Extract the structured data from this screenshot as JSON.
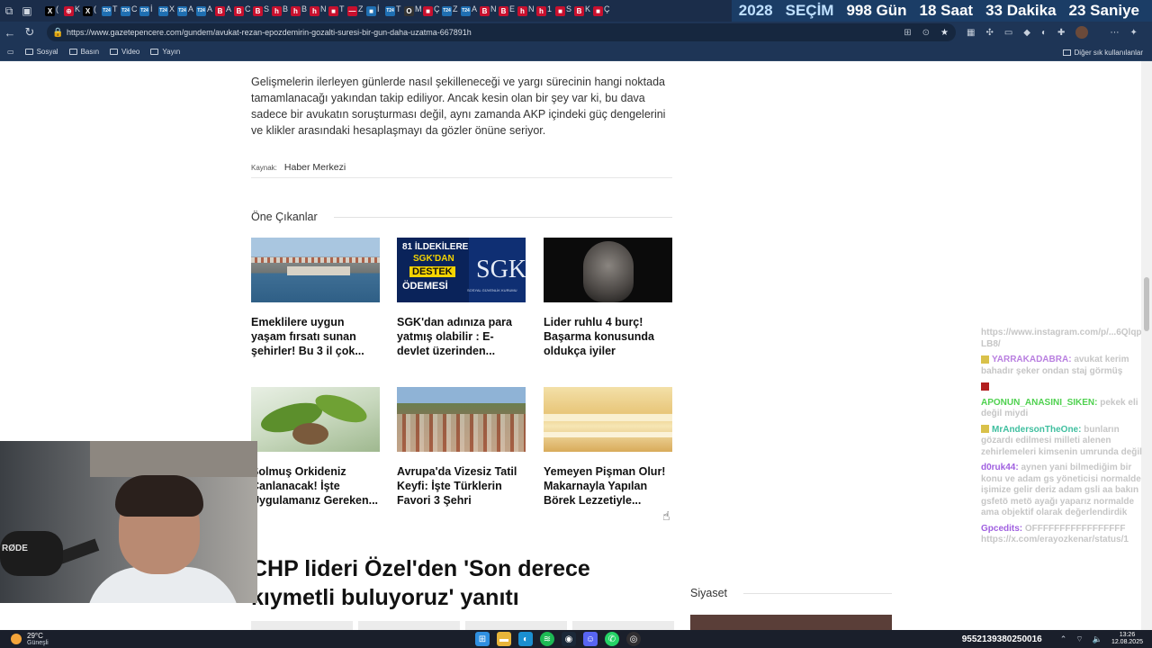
{
  "browser": {
    "tabs": [
      {
        "fav": "X",
        "color": "#000000",
        "t": "("
      },
      {
        "fav": "⊕",
        "color": "#c8102e",
        "t": "K"
      },
      {
        "fav": "X",
        "color": "#000000",
        "t": "("
      },
      {
        "fav": "T24",
        "color": "#1f6fb2",
        "t": "T"
      },
      {
        "fav": "T24",
        "color": "#1f6fb2",
        "t": "C"
      },
      {
        "fav": "T24",
        "color": "#1f6fb2",
        "t": "İ"
      },
      {
        "fav": "T24",
        "color": "#1f6fb2",
        "t": "X"
      },
      {
        "fav": "T24",
        "color": "#1f6fb2",
        "t": "A"
      },
      {
        "fav": "T24",
        "color": "#1f6fb2",
        "t": "A"
      },
      {
        "fav": "B",
        "color": "#c8102e",
        "t": "A"
      },
      {
        "fav": "B",
        "color": "#c8102e",
        "t": "C"
      },
      {
        "fav": "B",
        "color": "#c8102e",
        "t": "S"
      },
      {
        "fav": "h",
        "color": "#c8102e",
        "t": "B"
      },
      {
        "fav": "h",
        "color": "#c8102e",
        "t": "B"
      },
      {
        "fav": "h",
        "color": "#c8102e",
        "t": "N"
      },
      {
        "fav": "■",
        "color": "#c8102e",
        "t": "T"
      },
      {
        "fav": "—",
        "color": "#c8102e",
        "t": "Z"
      },
      {
        "fav": "■",
        "color": "#1f6fb2",
        "t": "İ"
      },
      {
        "fav": "T24",
        "color": "#1f6fb2",
        "t": "T"
      },
      {
        "fav": "O",
        "color": "#333333",
        "t": "M"
      },
      {
        "fav": "■",
        "color": "#c8102e",
        "t": "Ç"
      },
      {
        "fav": "T24",
        "color": "#1f6fb2",
        "t": "Z"
      },
      {
        "fav": "T24",
        "color": "#1f6fb2",
        "t": "A"
      },
      {
        "fav": "B",
        "color": "#c8102e",
        "t": "N"
      },
      {
        "fav": "B",
        "color": "#c8102e",
        "t": "E"
      },
      {
        "fav": "h",
        "color": "#c8102e",
        "t": "N"
      },
      {
        "fav": "h",
        "color": "#c8102e",
        "t": "1"
      },
      {
        "fav": "■",
        "color": "#c8102e",
        "t": "S"
      },
      {
        "fav": "B",
        "color": "#c8102e",
        "t": "K"
      },
      {
        "fav": "■",
        "color": "#c8102e",
        "t": "Ç"
      }
    ],
    "countdown": [
      "2028",
      "SEÇİM",
      "998 Gün",
      "18 Saat",
      "33 Dakika",
      "23 Saniye"
    ],
    "url": "https://www.gazetepencere.com/gundem/avukat-rezan-epozdemirin-gozalti-suresi-bir-gun-daha-uzatma-667891h",
    "bookmarks": [
      "Sosyal",
      "Basın",
      "Video",
      "Yayın"
    ],
    "bookmarks_other": "Diğer sık kullanılanlar"
  },
  "article": {
    "paragraph": "Gelişmelerin ilerleyen günlerde nasıl şekilleneceği ve yargı sürecinin hangi noktada tamamlanacağı yakından takip ediliyor. Ancak kesin olan bir şey var ki, bu dava sadece bir avukatın soruşturması değil, aynı zamanda AKP içindeki güç dengelerini ve klikler arasındaki hesaplaşmayı da gözler önüne seriyor.",
    "source_label": "Kaynak:",
    "source_value": "Haber Merkezi"
  },
  "featured": {
    "title": "Öne Çıkanlar",
    "cards": [
      {
        "title": "Emeklilere uygun yaşam fırsatı sunan şehirler! Bu 3 il çok..."
      },
      {
        "title": "SGK'dan adınıza para yatmış olabilir : E-devlet üzerinden..."
      },
      {
        "title": "Lider ruhlu 4 burç! Başarma konusunda oldukça iyiler"
      },
      {
        "title": "Solmuş Orkideniz Canlanacak! İşte Uygulamanız Gereken..."
      },
      {
        "title": "Avrupa'da Vizesiz Tatil Keyfi: İşte Türklerin Favori 3 Şehri"
      },
      {
        "title": "Yemeyen Pişman Olur! Makarnayla Yapılan Börek Lezzetiyle..."
      }
    ],
    "sgk_overlay": {
      "line1": "81 İLDEKİLERE",
      "line2": "SGK'DAN",
      "line3": "DESTEK",
      "line4": "ÖDEMESİ",
      "logo": "SGK",
      "sub": "SOSYAL GÜVENLİK KURUMU"
    }
  },
  "hero_title": "CHP lideri Özel'den 'Son derece kıymetli buluyoruz' yanıtı",
  "sidebar": {
    "title": "Siyaset"
  },
  "webcam": {
    "mic_brand": "RØDE"
  },
  "chat": [
    {
      "user": "",
      "text": "https://www.instagram.com/p/...6QlqpLB8/",
      "color": "#c6c6c6",
      "badge": ""
    },
    {
      "user": "YARRAKADABRA:",
      "text": "avukat kerim bahadır şeker ondan staj görmüş",
      "color": "#b97fe0",
      "badge": "gold"
    },
    {
      "user": "",
      "text": "",
      "color": "#c6c6c6",
      "badge": "red"
    },
    {
      "user": "APONUN_ANASINI_SIKEN:",
      "text": "pekek eli değil miydi",
      "color": "#4fd14f",
      "badge": ""
    },
    {
      "user": "MrAndersonTheOne:",
      "text": "bunların gözardı edilmesi milleti alenen zehirlemeleri kimsenin umrunda değil",
      "color": "#3fbf9f",
      "badge": "gold"
    },
    {
      "user": "d0ruk44:",
      "text": "aynen yani bilmediğim bir konu ve adam gs yöneticisi normalde işimize gelir deriz adam gsli aa bakın gsfetö metö ayağı yaparız normalde ama objektif olarak değerlendirdik",
      "color": "#a060e0",
      "badge": ""
    },
    {
      "user": "Gpcedits:",
      "text": "OFFFFFFFFFFFFFFFFF https://x.com/erayozkenar/status/1",
      "color": "#a060e0",
      "badge": ""
    }
  ],
  "taskbar": {
    "temp": "29°C",
    "condition": "Güneşli",
    "id_text": "9552139380250016",
    "time": "13:26",
    "date": "12.08.2025"
  }
}
